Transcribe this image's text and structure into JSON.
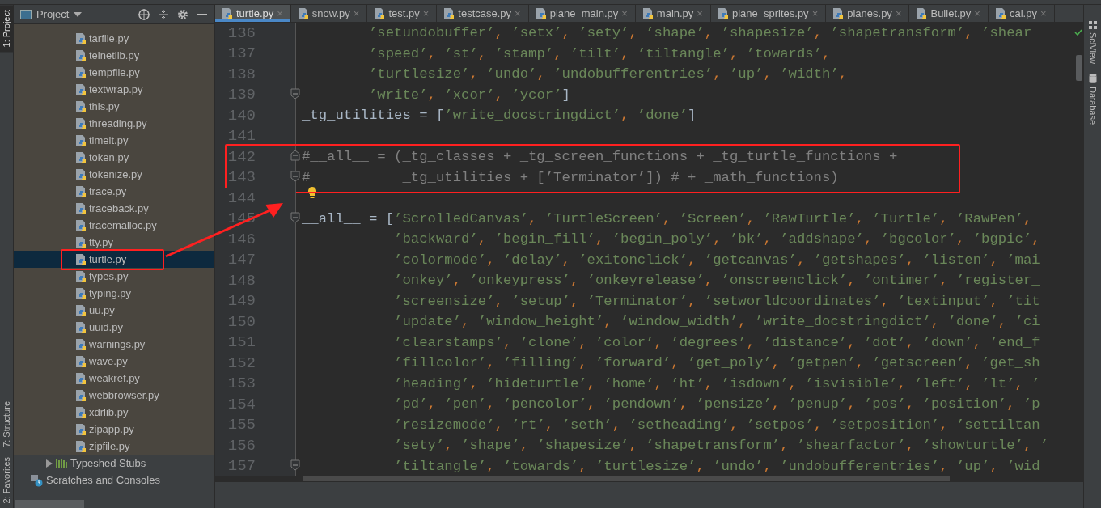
{
  "tool_strip_left": [
    {
      "label": "1: Project",
      "selected": true
    },
    {
      "label": "7: Structure",
      "selected": false
    },
    {
      "label": "2: Favorites",
      "selected": false
    }
  ],
  "project": {
    "title": "Project",
    "items": [
      {
        "label": "tarfile.py",
        "selected": false,
        "boxed": false
      },
      {
        "label": "telnetlib.py",
        "selected": false,
        "boxed": false
      },
      {
        "label": "tempfile.py",
        "selected": false,
        "boxed": false
      },
      {
        "label": "textwrap.py",
        "selected": false,
        "boxed": false
      },
      {
        "label": "this.py",
        "selected": false,
        "boxed": false
      },
      {
        "label": "threading.py",
        "selected": false,
        "boxed": false
      },
      {
        "label": "timeit.py",
        "selected": false,
        "boxed": false
      },
      {
        "label": "token.py",
        "selected": false,
        "boxed": false
      },
      {
        "label": "tokenize.py",
        "selected": false,
        "boxed": false
      },
      {
        "label": "trace.py",
        "selected": false,
        "boxed": false
      },
      {
        "label": "traceback.py",
        "selected": false,
        "boxed": false
      },
      {
        "label": "tracemalloc.py",
        "selected": false,
        "boxed": false
      },
      {
        "label": "tty.py",
        "selected": false,
        "boxed": false
      },
      {
        "label": "turtle.py",
        "selected": true,
        "boxed": true
      },
      {
        "label": "types.py",
        "selected": false,
        "boxed": false
      },
      {
        "label": "typing.py",
        "selected": false,
        "boxed": false
      },
      {
        "label": "uu.py",
        "selected": false,
        "boxed": false
      },
      {
        "label": "uuid.py",
        "selected": false,
        "boxed": false
      },
      {
        "label": "warnings.py",
        "selected": false,
        "boxed": false
      },
      {
        "label": "wave.py",
        "selected": false,
        "boxed": false
      },
      {
        "label": "weakref.py",
        "selected": false,
        "boxed": false
      },
      {
        "label": "webbrowser.py",
        "selected": false,
        "boxed": false
      },
      {
        "label": "xdrlib.py",
        "selected": false,
        "boxed": false
      },
      {
        "label": "zipapp.py",
        "selected": false,
        "boxed": false
      },
      {
        "label": "zipfile.py",
        "selected": false,
        "boxed": false
      }
    ],
    "roots": [
      {
        "kind": "stubs",
        "label": "Typeshed Stubs",
        "expanded": false
      },
      {
        "kind": "scratches",
        "label": "Scratches and Consoles"
      }
    ]
  },
  "tabs": [
    {
      "label": "turtle.py",
      "close": "×",
      "selected": true
    },
    {
      "label": "snow.py",
      "close": "×",
      "selected": false
    },
    {
      "label": "test.py",
      "close": "×",
      "selected": false
    },
    {
      "label": "testcase.py",
      "close": "×",
      "selected": false
    },
    {
      "label": "plane_main.py",
      "close": "×",
      "selected": false
    },
    {
      "label": "main.py",
      "close": "×",
      "selected": false
    },
    {
      "label": "plane_sprites.py",
      "close": "×",
      "selected": false
    },
    {
      "label": "planes.py",
      "close": "×",
      "selected": false
    },
    {
      "label": "Bullet.py",
      "close": "×",
      "selected": false
    },
    {
      "label": "cal.py",
      "close": "×",
      "selected": false
    }
  ],
  "code_lines": [
    {
      "number": "136",
      "kind": "code",
      "fold": false,
      "boxed": false,
      "text": "        ’setundobuffer’, ’setx’, ’sety’, ’shape’, ’shapesize’, ’shapetransform’, ’shear"
    },
    {
      "number": "137",
      "kind": "code",
      "fold": false,
      "boxed": false,
      "text": "        ’speed’, ’st’, ’stamp’, ’tilt’, ’tiltangle’, ’towards’,"
    },
    {
      "number": "138",
      "kind": "code",
      "fold": false,
      "boxed": false,
      "text": "        ’turtlesize’, ’undo’, ’undobufferentries’, ’up’, ’width’,"
    },
    {
      "number": "139",
      "kind": "code",
      "fold": true,
      "boxed": false,
      "text": "        ’write’, ’xcor’, ’ycor’]"
    },
    {
      "number": "140",
      "kind": "code",
      "fold": false,
      "boxed": false,
      "text": "_tg_utilities = [’write_docstringdict’, ’done’]"
    },
    {
      "number": "141",
      "kind": "code",
      "fold": false,
      "boxed": false
    },
    {
      "number": "142",
      "kind": "comment",
      "fold": true,
      "boxed": true,
      "text": "#__all__ = (_tg_classes + _tg_screen_functions + _tg_turtle_functions +"
    },
    {
      "number": "143",
      "kind": "comment",
      "fold": true,
      "boxed": true,
      "text": "#           _tg_utilities + [’Terminator’]) # + _math_functions)"
    },
    {
      "number": "144",
      "kind": "bulb",
      "fold": false,
      "boxed": false
    },
    {
      "number": "145",
      "kind": "code",
      "fold": true,
      "boxed": false,
      "text": "__all__ = [’ScrolledCanvas’, ’TurtleScreen’, ’Screen’, ’RawTurtle’, ’Turtle’, ’RawPen’,"
    },
    {
      "number": "146",
      "kind": "code",
      "fold": false,
      "boxed": false,
      "text": "           ’backward’, ’begin_fill’, ’begin_poly’, ’bk’, ’addshape’, ’bgcolor’, ’bgpic’,"
    },
    {
      "number": "147",
      "kind": "code",
      "fold": false,
      "boxed": false,
      "text": "           ’colormode’, ’delay’, ’exitonclick’, ’getcanvas’, ’getshapes’, ’listen’, ’mai"
    },
    {
      "number": "148",
      "kind": "code",
      "fold": false,
      "boxed": false,
      "text": "           ’onkey’, ’onkeypress’, ’onkeyrelease’, ’onscreenclick’, ’ontimer’, ’register_"
    },
    {
      "number": "149",
      "kind": "code",
      "fold": false,
      "boxed": false,
      "text": "           ’screensize’, ’setup’, ’Terminator’, ’setworldcoordinates’, ’textinput’, ’tit"
    },
    {
      "number": "150",
      "kind": "code",
      "fold": false,
      "boxed": false,
      "text": "           ’update’, ’window_height’, ’window_width’, ’write_docstringdict’, ’done’, ’ci"
    },
    {
      "number": "151",
      "kind": "code",
      "fold": false,
      "boxed": false,
      "text": "           ’clearstamps’, ’clone’, ’color’, ’degrees’, ’distance’, ’dot’, ’down’, ’end_f"
    },
    {
      "number": "152",
      "kind": "code",
      "fold": false,
      "boxed": false,
      "text": "           ’fillcolor’, ’filling’, ’forward’, ’get_poly’, ’getpen’, ’getscreen’, ’get_sh"
    },
    {
      "number": "153",
      "kind": "code",
      "fold": false,
      "boxed": false,
      "text": "           ’heading’, ’hideturtle’, ’home’, ’ht’, ’isdown’, ’isvisible’, ’left’, ’lt’, ’"
    },
    {
      "number": "154",
      "kind": "code",
      "fold": false,
      "boxed": false,
      "text": "           ’pd’, ’pen’, ’pencolor’, ’pendown’, ’pensize’, ’penup’, ’pos’, ’position’, ’p"
    },
    {
      "number": "155",
      "kind": "code",
      "fold": false,
      "boxed": false,
      "text": "           ’resizemode’, ’rt’, ’seth’, ’setheading’, ’setpos’, ’setposition’, ’settiltan"
    },
    {
      "number": "156",
      "kind": "code",
      "fold": false,
      "boxed": false,
      "text": "           ’sety’, ’shape’, ’shapesize’, ’shapetransform’, ’shearfactor’, ’showturtle’, ’"
    },
    {
      "number": "157",
      "kind": "code",
      "fold": true,
      "boxed": false,
      "text": "           ’tiltangle’, ’towards’, ’turtlesize’, ’undo’, ’undobufferentries’, ’up’, ’wid"
    }
  ],
  "tool_strip_right": [
    {
      "kind": "sciview",
      "label": "SciView"
    },
    {
      "kind": "database",
      "label": "Database"
    }
  ]
}
